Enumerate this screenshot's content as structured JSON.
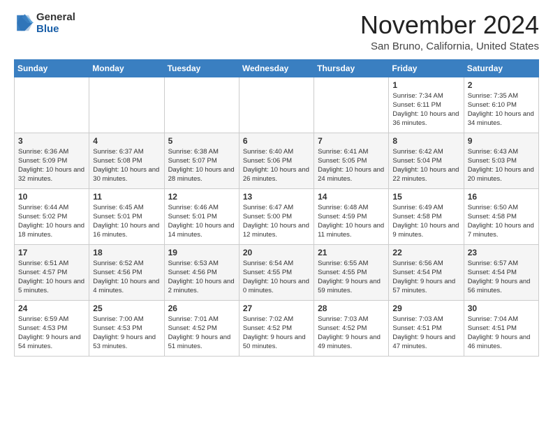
{
  "logo": {
    "general": "General",
    "blue": "Blue"
  },
  "header": {
    "month": "November 2024",
    "location": "San Bruno, California, United States"
  },
  "weekdays": [
    "Sunday",
    "Monday",
    "Tuesday",
    "Wednesday",
    "Thursday",
    "Friday",
    "Saturday"
  ],
  "weeks": [
    [
      {
        "day": "",
        "info": ""
      },
      {
        "day": "",
        "info": ""
      },
      {
        "day": "",
        "info": ""
      },
      {
        "day": "",
        "info": ""
      },
      {
        "day": "",
        "info": ""
      },
      {
        "day": "1",
        "info": "Sunrise: 7:34 AM\nSunset: 6:11 PM\nDaylight: 10 hours\nand 36 minutes."
      },
      {
        "day": "2",
        "info": "Sunrise: 7:35 AM\nSunset: 6:10 PM\nDaylight: 10 hours\nand 34 minutes."
      }
    ],
    [
      {
        "day": "3",
        "info": "Sunrise: 6:36 AM\nSunset: 5:09 PM\nDaylight: 10 hours\nand 32 minutes."
      },
      {
        "day": "4",
        "info": "Sunrise: 6:37 AM\nSunset: 5:08 PM\nDaylight: 10 hours\nand 30 minutes."
      },
      {
        "day": "5",
        "info": "Sunrise: 6:38 AM\nSunset: 5:07 PM\nDaylight: 10 hours\nand 28 minutes."
      },
      {
        "day": "6",
        "info": "Sunrise: 6:40 AM\nSunset: 5:06 PM\nDaylight: 10 hours\nand 26 minutes."
      },
      {
        "day": "7",
        "info": "Sunrise: 6:41 AM\nSunset: 5:05 PM\nDaylight: 10 hours\nand 24 minutes."
      },
      {
        "day": "8",
        "info": "Sunrise: 6:42 AM\nSunset: 5:04 PM\nDaylight: 10 hours\nand 22 minutes."
      },
      {
        "day": "9",
        "info": "Sunrise: 6:43 AM\nSunset: 5:03 PM\nDaylight: 10 hours\nand 20 minutes."
      }
    ],
    [
      {
        "day": "10",
        "info": "Sunrise: 6:44 AM\nSunset: 5:02 PM\nDaylight: 10 hours\nand 18 minutes."
      },
      {
        "day": "11",
        "info": "Sunrise: 6:45 AM\nSunset: 5:01 PM\nDaylight: 10 hours\nand 16 minutes."
      },
      {
        "day": "12",
        "info": "Sunrise: 6:46 AM\nSunset: 5:01 PM\nDaylight: 10 hours\nand 14 minutes."
      },
      {
        "day": "13",
        "info": "Sunrise: 6:47 AM\nSunset: 5:00 PM\nDaylight: 10 hours\nand 12 minutes."
      },
      {
        "day": "14",
        "info": "Sunrise: 6:48 AM\nSunset: 4:59 PM\nDaylight: 10 hours\nand 11 minutes."
      },
      {
        "day": "15",
        "info": "Sunrise: 6:49 AM\nSunset: 4:58 PM\nDaylight: 10 hours\nand 9 minutes."
      },
      {
        "day": "16",
        "info": "Sunrise: 6:50 AM\nSunset: 4:58 PM\nDaylight: 10 hours\nand 7 minutes."
      }
    ],
    [
      {
        "day": "17",
        "info": "Sunrise: 6:51 AM\nSunset: 4:57 PM\nDaylight: 10 hours\nand 5 minutes."
      },
      {
        "day": "18",
        "info": "Sunrise: 6:52 AM\nSunset: 4:56 PM\nDaylight: 10 hours\nand 4 minutes."
      },
      {
        "day": "19",
        "info": "Sunrise: 6:53 AM\nSunset: 4:56 PM\nDaylight: 10 hours\nand 2 minutes."
      },
      {
        "day": "20",
        "info": "Sunrise: 6:54 AM\nSunset: 4:55 PM\nDaylight: 10 hours\nand 0 minutes."
      },
      {
        "day": "21",
        "info": "Sunrise: 6:55 AM\nSunset: 4:55 PM\nDaylight: 9 hours\nand 59 minutes."
      },
      {
        "day": "22",
        "info": "Sunrise: 6:56 AM\nSunset: 4:54 PM\nDaylight: 9 hours\nand 57 minutes."
      },
      {
        "day": "23",
        "info": "Sunrise: 6:57 AM\nSunset: 4:54 PM\nDaylight: 9 hours\nand 56 minutes."
      }
    ],
    [
      {
        "day": "24",
        "info": "Sunrise: 6:59 AM\nSunset: 4:53 PM\nDaylight: 9 hours\nand 54 minutes."
      },
      {
        "day": "25",
        "info": "Sunrise: 7:00 AM\nSunset: 4:53 PM\nDaylight: 9 hours\nand 53 minutes."
      },
      {
        "day": "26",
        "info": "Sunrise: 7:01 AM\nSunset: 4:52 PM\nDaylight: 9 hours\nand 51 minutes."
      },
      {
        "day": "27",
        "info": "Sunrise: 7:02 AM\nSunset: 4:52 PM\nDaylight: 9 hours\nand 50 minutes."
      },
      {
        "day": "28",
        "info": "Sunrise: 7:03 AM\nSunset: 4:52 PM\nDaylight: 9 hours\nand 49 minutes."
      },
      {
        "day": "29",
        "info": "Sunrise: 7:03 AM\nSunset: 4:51 PM\nDaylight: 9 hours\nand 47 minutes."
      },
      {
        "day": "30",
        "info": "Sunrise: 7:04 AM\nSunset: 4:51 PM\nDaylight: 9 hours\nand 46 minutes."
      }
    ]
  ]
}
